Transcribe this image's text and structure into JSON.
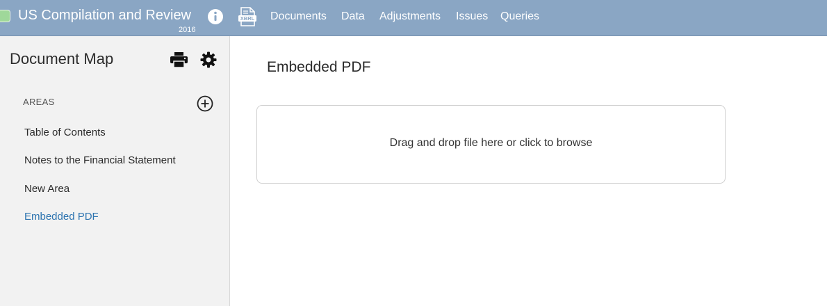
{
  "header": {
    "app_title": "US Compilation and Review",
    "year": "2016",
    "nav": [
      "Documents",
      "Data",
      "Adjustments",
      "Issues",
      "Queries"
    ]
  },
  "sidebar": {
    "title": "Document Map",
    "section_label": "AREAS",
    "items": [
      {
        "label": "Table of Contents",
        "active": false
      },
      {
        "label": "Notes to the Financial Statement",
        "active": false
      },
      {
        "label": "New Area",
        "active": false
      },
      {
        "label": "Embedded PDF",
        "active": true
      }
    ]
  },
  "main": {
    "title": "Embedded PDF",
    "dropzone_text": "Drag and drop file here or click to browse"
  },
  "colors": {
    "header_bg": "#8aa6c4",
    "sidebar_bg": "#f2f2f2",
    "active_item": "#2d74b0",
    "status_dot": "#9fd89a"
  },
  "icons": [
    "info-icon",
    "xbrl-icon",
    "print-icon",
    "gear-icon",
    "add-circle-icon"
  ]
}
